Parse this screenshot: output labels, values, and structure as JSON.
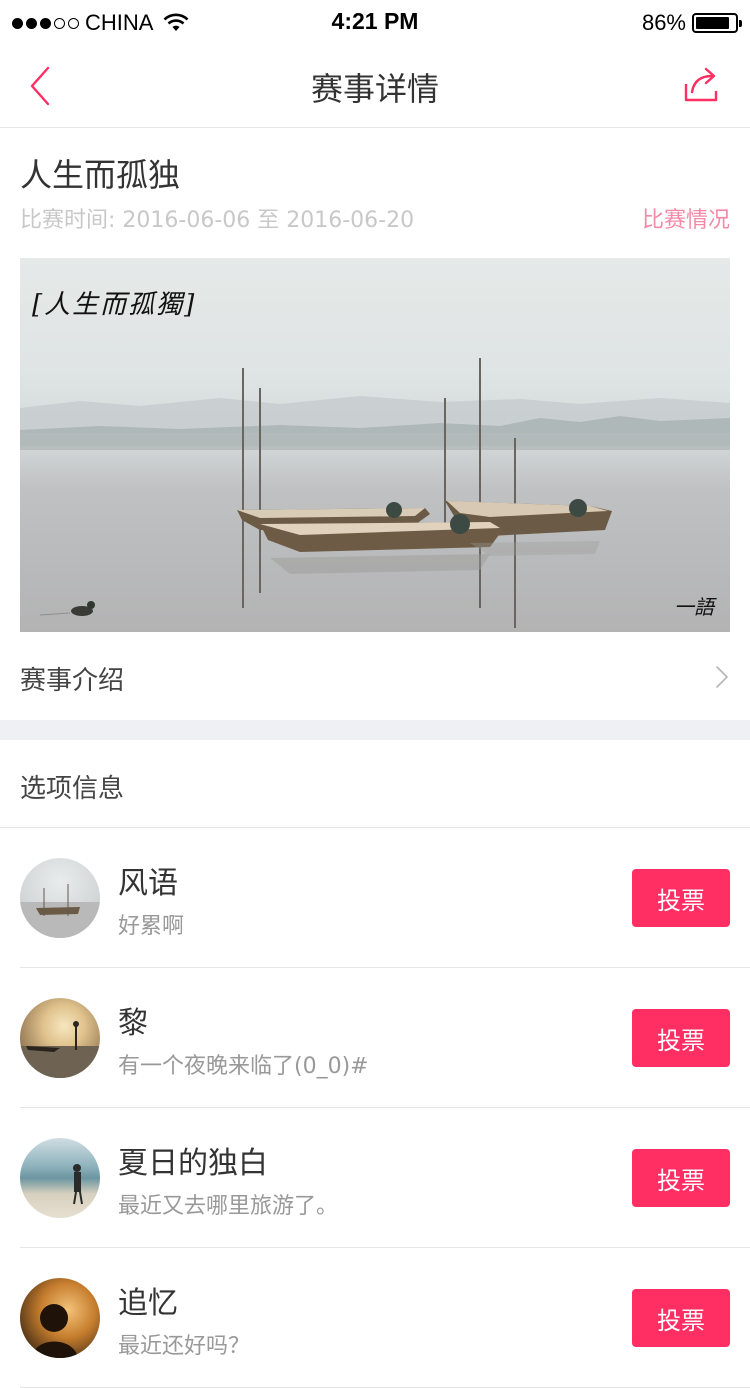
{
  "status_bar": {
    "carrier": "CHINA",
    "time": "4:21 PM",
    "battery": "86%",
    "battery_level": 0.86,
    "signal_bars_filled": 3,
    "signal_bars_total": 5
  },
  "navbar": {
    "title": "赛事详情",
    "back_icon": "chevron-left-icon",
    "share_icon": "share-icon",
    "accent_color": "#ff2e63"
  },
  "event": {
    "title": "人生而孤独",
    "time_text": "比赛时间: 2016-06-06 至 2016-06-20",
    "status_link": "比赛情况",
    "banner_caption": "[人生而孤獨]",
    "banner_signature": "一語"
  },
  "intro": {
    "label": "赛事介绍"
  },
  "options": {
    "header": "选项信息",
    "vote_label": "投票",
    "items": [
      {
        "name": "风语",
        "desc": "好累啊"
      },
      {
        "name": "黎",
        "desc": "有一个夜晚来临了(0_0)#"
      },
      {
        "name": "夏日的独白",
        "desc": "最近又去哪里旅游了。"
      },
      {
        "name": "追忆",
        "desc": "最近还好吗？"
      }
    ]
  }
}
